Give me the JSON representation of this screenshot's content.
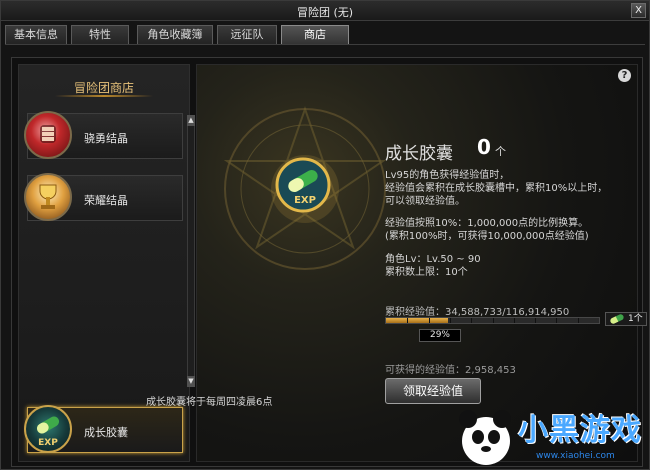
{
  "window": {
    "title": "冒险团 (无)",
    "close_label": "X"
  },
  "tabs": [
    {
      "label": "基本信息",
      "active": false
    },
    {
      "label": "特性",
      "active": false
    },
    {
      "label": "角色收藏簿",
      "active": false
    },
    {
      "label": "远征队",
      "active": false
    },
    {
      "label": "商店",
      "active": true
    }
  ],
  "sidebar": {
    "title": "冒险团商店",
    "items": [
      {
        "label": "骁勇结晶",
        "icon": "fist-crystal-icon"
      },
      {
        "label": "荣耀结晶",
        "icon": "trophy-crystal-icon"
      }
    ],
    "selected_item": {
      "label": "成长胶囊",
      "icon": "exp-capsule-icon",
      "icon_text": "EXP"
    }
  },
  "content": {
    "help_label": "?",
    "capsule_icon_text": "EXP",
    "title": "成长胶囊",
    "count": "0",
    "count_unit": "个",
    "description_lines": [
      "Lv95的角色获得经验值时，",
      "经验值会累积在成长胶囊槽中，累积10%以上时，",
      "可以领取经验值。",
      "",
      "经验值按照10%：1,000,000点的比例换算。",
      "(累积100%时，可获得10,000,000点经验值)",
      "",
      "角色Lv：Lv.50 ~ 90",
      "累积数上限：10个"
    ],
    "exp_label": "累积经验值：34,588,733/116,914,950",
    "exp_progress": 0.29,
    "exp_percent": "29%",
    "mini_capsule_count": "1个",
    "obtainable": "可获得的经验值：2,958,453",
    "claim_button": "领取经验值"
  },
  "footer_note": "成长胶囊将于每周四凌晨6点",
  "watermark": {
    "text": "小黑游戏",
    "url": "www.xiaohei.com"
  },
  "colors": {
    "accent_gold": "#d4a437",
    "bar_fill": "#e8b24a",
    "watermark_blue": "#4aa8ff"
  }
}
